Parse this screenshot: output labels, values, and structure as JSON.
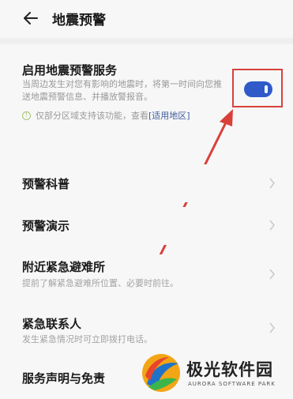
{
  "header": {
    "title": "地震预警"
  },
  "service": {
    "title": "启用地震预警服务",
    "description": "当周边发生对您有影响的地震时，将第一时间向您推送地震预警信息、并播放警报音。",
    "tip_text": "仅部分区域支持该功能，查看",
    "tip_link": "[适用地区]",
    "toggle_on": true
  },
  "menu": [
    {
      "title": "预警科普",
      "subtitle": ""
    },
    {
      "title": "预警演示",
      "subtitle": ""
    },
    {
      "title": "附近紧急避难所",
      "subtitle": "提前了解紧急避难所位置、必要时前往。"
    },
    {
      "title": "紧急联系人",
      "subtitle": "发生紧急情况时可立即拨打电话。"
    },
    {
      "title": "服务声明与免责",
      "subtitle": ""
    }
  ],
  "watermark": {
    "name": "极光软件园",
    "name_en": "AURORA SOFTWARE PARK"
  },
  "colors": {
    "accent": "#2f5ac8",
    "annotation": "#d9403a"
  }
}
